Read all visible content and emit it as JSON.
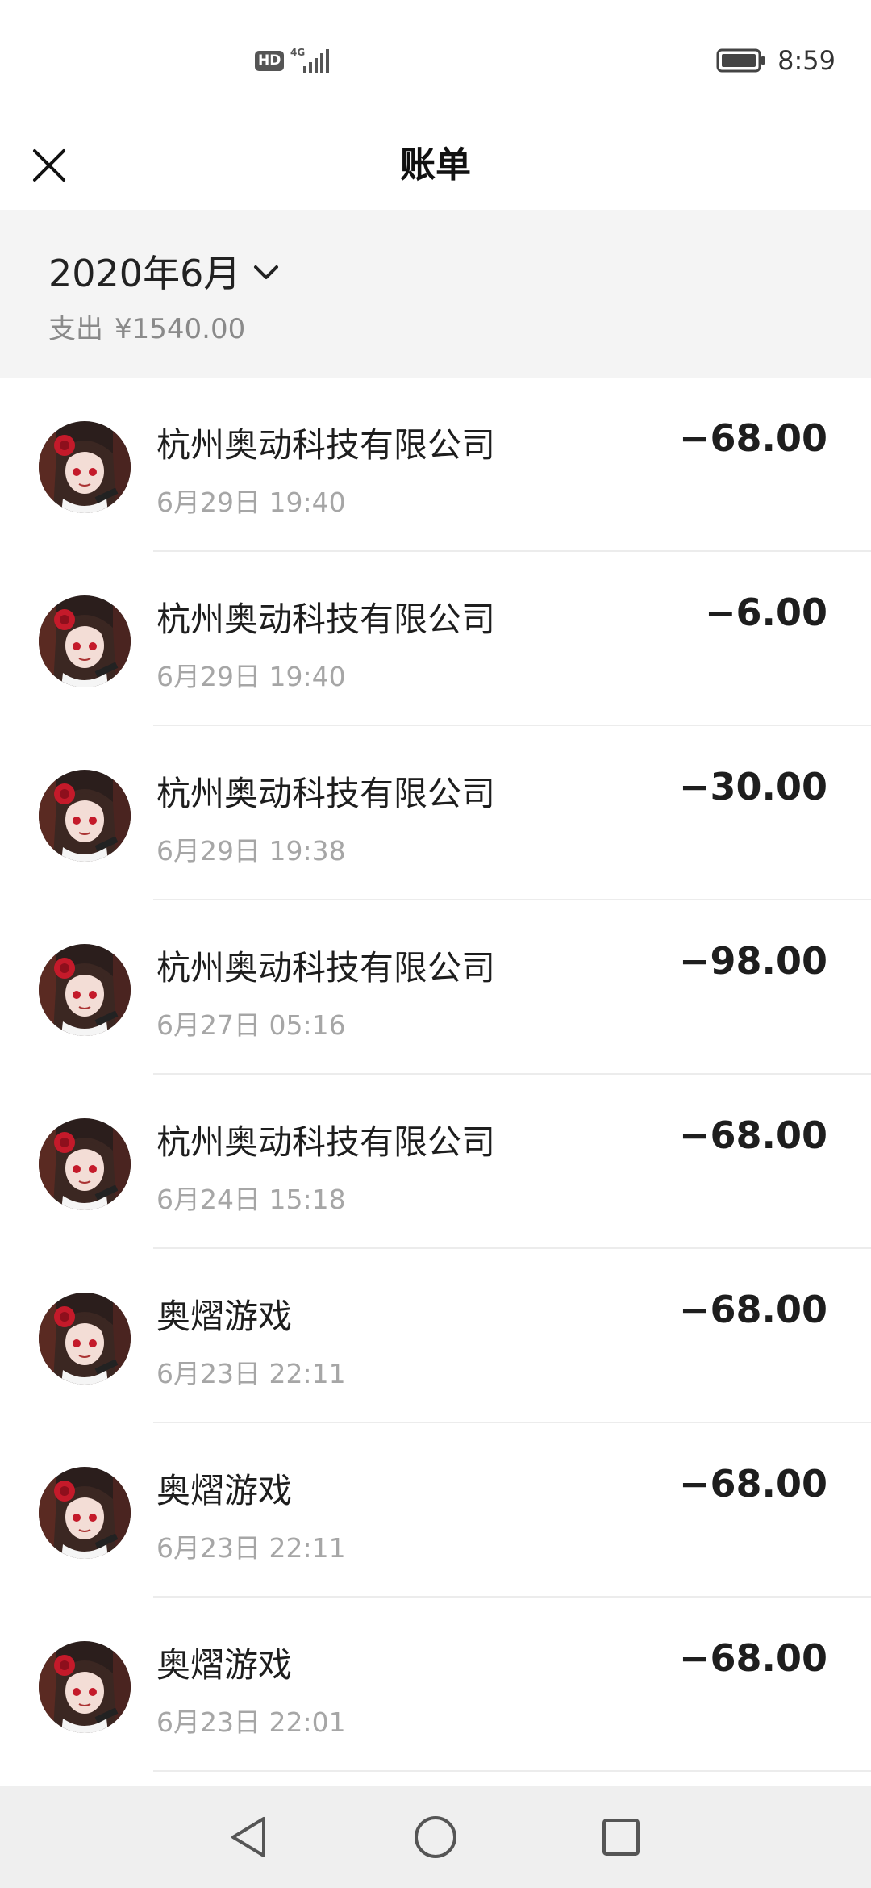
{
  "status_bar": {
    "network_badge": "HD",
    "network_type": "4G",
    "time": "8:59",
    "icons": [
      "hd-icon",
      "signal-icon",
      "battery-icon"
    ]
  },
  "header": {
    "title": "账单",
    "close_icon": "close-icon"
  },
  "summary": {
    "month": "2020年6月",
    "expense_label": "支出",
    "expense_amount": "¥1540.00"
  },
  "bills": [
    {
      "merchant": "杭州奥动科技有限公司",
      "datetime": "6月29日 19:40",
      "amount": "−68.00"
    },
    {
      "merchant": "杭州奥动科技有限公司",
      "datetime": "6月29日 19:40",
      "amount": "−6.00"
    },
    {
      "merchant": "杭州奥动科技有限公司",
      "datetime": "6月29日 19:38",
      "amount": "−30.00"
    },
    {
      "merchant": "杭州奥动科技有限公司",
      "datetime": "6月27日 05:16",
      "amount": "−98.00"
    },
    {
      "merchant": "杭州奥动科技有限公司",
      "datetime": "6月24日 15:18",
      "amount": "−68.00"
    },
    {
      "merchant": "奥熠游戏",
      "datetime": "6月23日 22:11",
      "amount": "−68.00"
    },
    {
      "merchant": "奥熠游戏",
      "datetime": "6月23日 22:11",
      "amount": "−68.00"
    },
    {
      "merchant": "奥熠游戏",
      "datetime": "6月23日 22:01",
      "amount": "−68.00"
    }
  ],
  "nav_bar": {
    "icons": [
      "back-triangle-icon",
      "home-circle-icon",
      "recents-square-icon"
    ]
  },
  "colors": {
    "summary_bg": "#f4f4f4",
    "nav_bg": "#efefef",
    "secondary_text": "#a6a6a6",
    "avatar_accent": "#c41a2a"
  }
}
